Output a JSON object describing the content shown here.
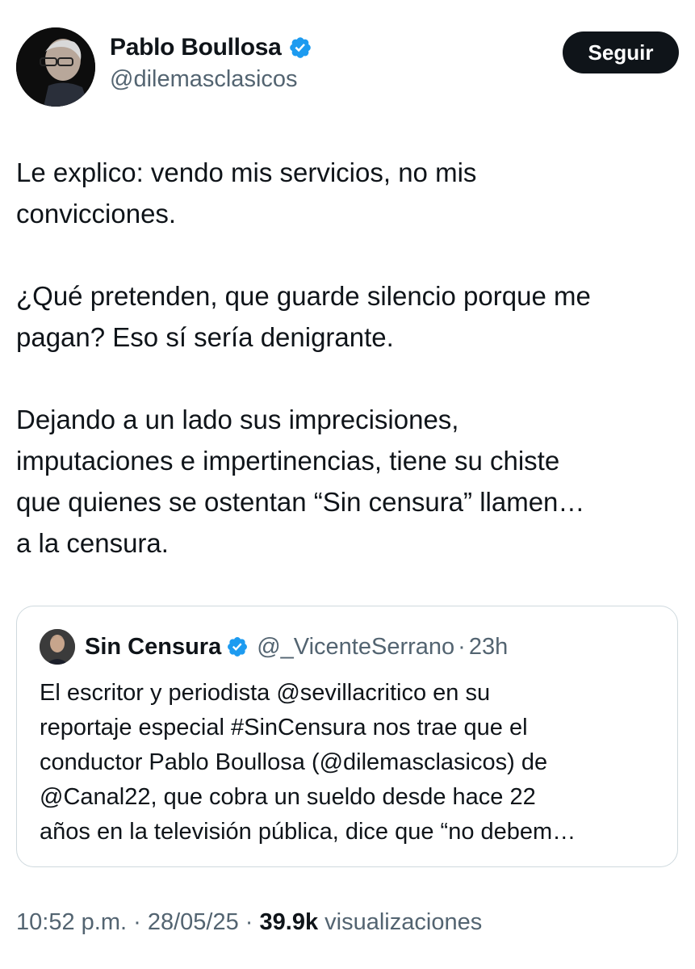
{
  "author": {
    "name": "Pablo Boullosa",
    "handle": "@dilemasclasicos",
    "avatar_icon": "profile-photo",
    "verified_icon": "verified-badge-icon"
  },
  "follow_label": "Seguir",
  "tweet": {
    "paragraph1": [
      "Le explico: vendo mis servicios, no mis",
      "convicciones."
    ],
    "paragraph2": [
      "¿Qué pretenden, que guarde silencio porque me",
      "pagan?  Eso sí sería denigrante."
    ],
    "paragraph3": [
      "Dejando a un lado sus imprecisiones,",
      "imputaciones e impertinencias, tiene su chiste",
      "que quienes se ostentan “Sin censura” llamen…",
      "a la censura."
    ]
  },
  "quoted": {
    "name": "Sin Censura",
    "handle": "@_VicenteSerrano",
    "separator": "·",
    "time": "23h",
    "lines": [
      "El escritor y periodista @sevillacritico en su",
      "reportaje especial #SinCensura nos trae que el",
      "conductor Pablo Boullosa (@dilemasclasicos) de",
      "@Canal22, que cobra un sueldo desde hace 22",
      "años en la televisión pública, dice que “no debem…"
    ]
  },
  "meta": {
    "time": "10:52 p.m.",
    "sep1": "·",
    "date": "28/05/25",
    "sep2": "·",
    "views_count": "39.9k",
    "views_label": "visualizaciones"
  },
  "colors": {
    "text": "#0f1419",
    "secondary": "#536471",
    "verified": "#1d9bf0",
    "border": "#cfd9de"
  }
}
